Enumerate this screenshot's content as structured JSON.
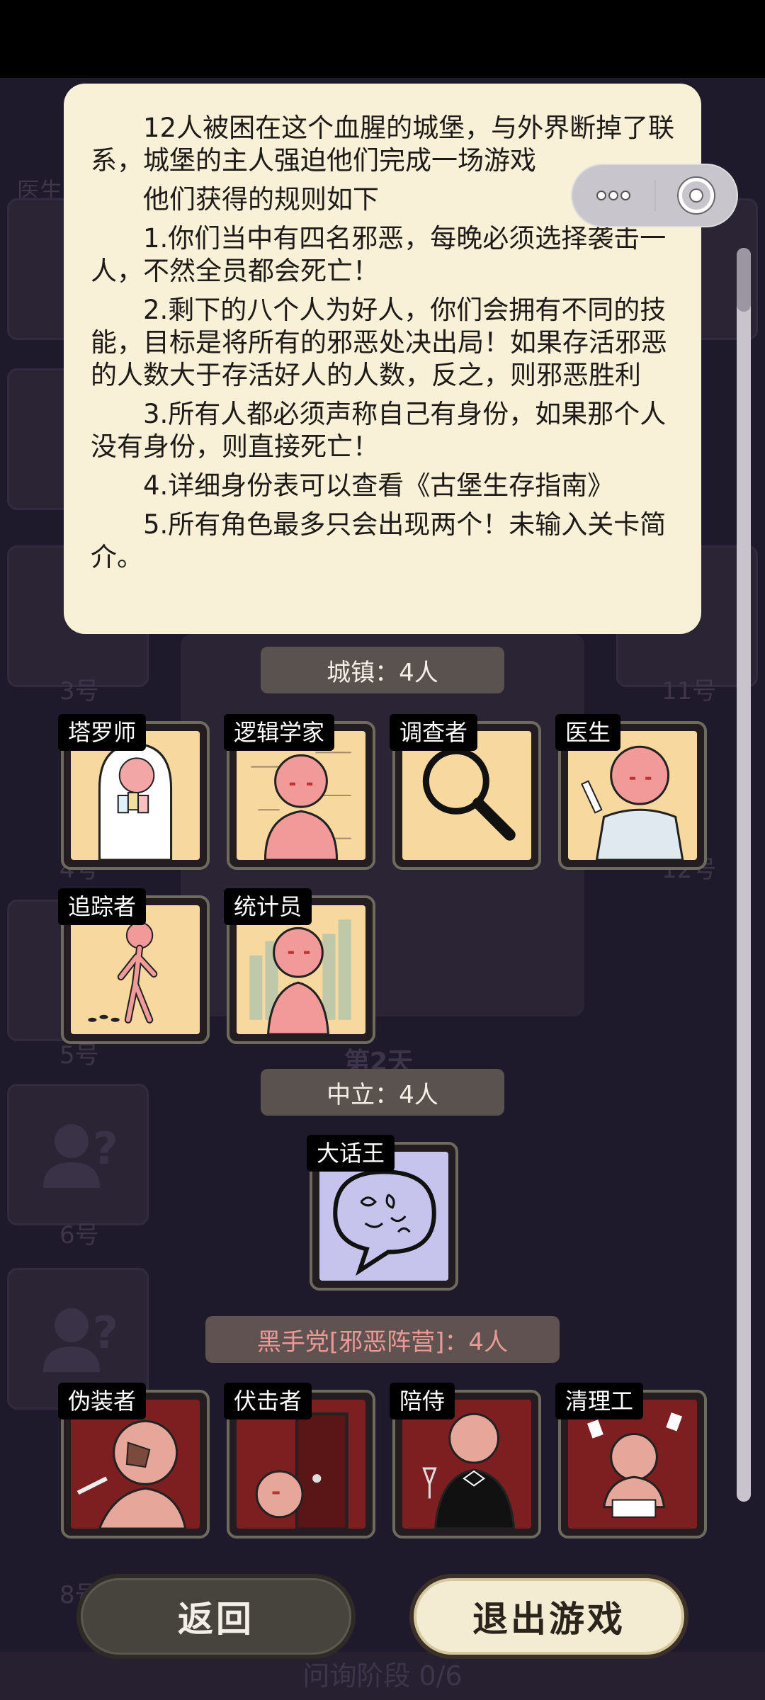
{
  "rules": {
    "paragraphs": [
      "12人被困在这个血腥的城堡，与外界断掉了联系，城堡的主人强迫他们完成一场游戏",
      "他们获得的规则如下",
      "1.你们当中有四名邪恶，每晚必须选择袭击一人，不然全员都会死亡！",
      "2.剩下的八个人为好人，你们会拥有不同的技能，目标是将所有的邪恶处决出局！如果存活邪恶的人数大于存活好人的人数，反之，则邪恶胜利",
      "3.所有人都必须声称自己有身份，如果那个人没有身份，则直接死亡！",
      "4.详细身份表可以查看《古堡生存指南》",
      "5.所有角色最多只会出现两个！未输入关卡简介。"
    ]
  },
  "sections": {
    "town": "城镇：4人",
    "neutral": "中立：4人",
    "evil": "黑手党[邪恶阵营]：4人"
  },
  "roles": {
    "town": [
      "塔罗师",
      "逻辑学家",
      "调查者",
      "医生",
      "追踪者",
      "统计员"
    ],
    "neutral": [
      "大话王"
    ],
    "evil": [
      "伪装者",
      "伏击者",
      "陪侍",
      "清理工"
    ]
  },
  "background": {
    "top_label": "医生",
    "seat_numbers": [
      "3号",
      "4号",
      "5号",
      "6号",
      "8号",
      "11号",
      "12号"
    ],
    "day_label": "第2天",
    "phase": "问询阶段 0/6"
  },
  "buttons": {
    "back": "返回",
    "exit": "退出游戏"
  },
  "colors": {
    "card_bg": "#f8f1d7",
    "town_art": "#f7d9a0",
    "neutral_art": "#c6c4ed",
    "evil_art": "#7d1f20",
    "evil_text": "#e99a95"
  }
}
